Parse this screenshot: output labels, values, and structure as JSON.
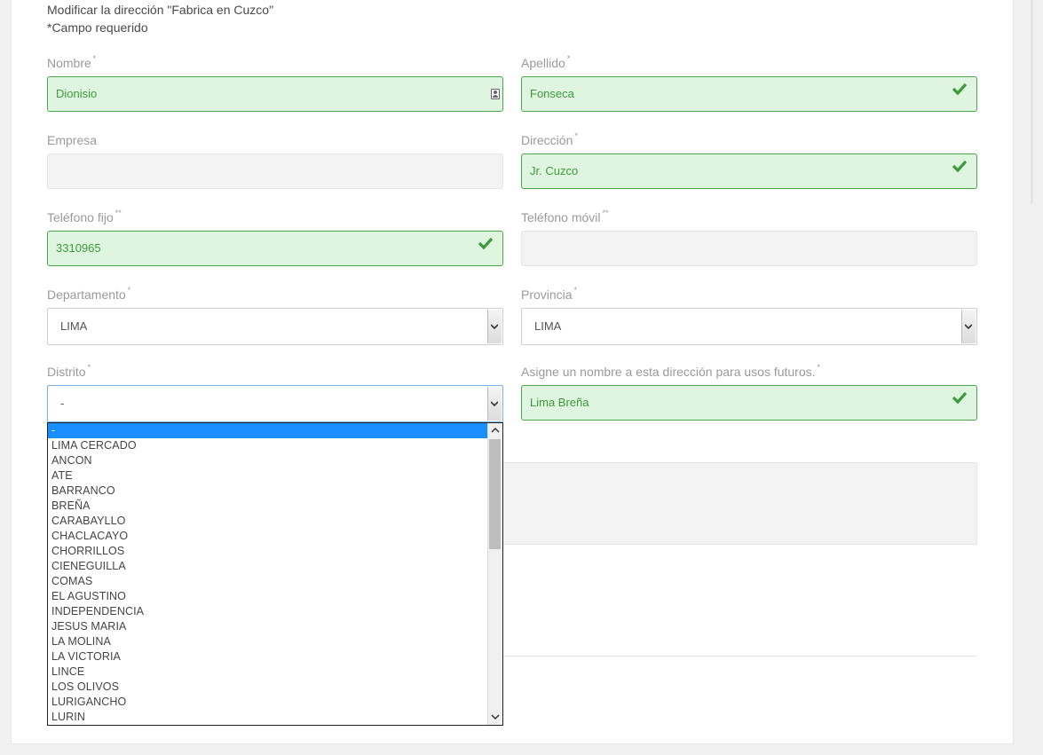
{
  "form": {
    "title": "Modificar la dirección \"Fabrica en Cuzco\"",
    "required_note": "*Campo requerido",
    "fields": {
      "nombre": {
        "label": "Nombre",
        "req": "*",
        "value": "Dionisio"
      },
      "apellido": {
        "label": "Apellido",
        "req": "*",
        "value": "Fonseca"
      },
      "empresa": {
        "label": "Empresa",
        "value": ""
      },
      "direccion": {
        "label": "Dirección",
        "req": "*",
        "value": "Jr. Cuzco"
      },
      "telefono_fijo": {
        "label": "Teléfono fijo",
        "req": "**",
        "value": "3310965"
      },
      "telefono_movil": {
        "label": "Teléfono móvil",
        "req": "**",
        "value": ""
      },
      "departamento": {
        "label": "Departamento",
        "req": "*",
        "value": "LIMA"
      },
      "provincia": {
        "label": "Provincia",
        "req": "*",
        "value": "LIMA"
      },
      "distrito": {
        "label": "Distrito",
        "req": "*",
        "value": "-"
      },
      "alias": {
        "label": "Asigne un nombre a esta dirección para usos futuros.",
        "req": "*",
        "value": "Lima Breña"
      }
    },
    "distrito_options": [
      "-",
      "LIMA CERCADO",
      "ANCON",
      "ATE",
      "BARRANCO",
      "BREÑA",
      "CARABAYLLO",
      "CHACLACAYO",
      "CHORRILLOS",
      "CIENEGUILLA",
      "COMAS",
      "EL AGUSTINO",
      "INDEPENDENCIA",
      "JESUS MARIA",
      "LA MOLINA",
      "LA VICTORIA",
      "LINCE",
      "LOS OLIVOS",
      "LURIGANCHO",
      "LURIN"
    ]
  },
  "colors": {
    "valid_bg": "#dff5df",
    "valid_border": "#4aa84a",
    "empty_bg": "#f3f3f3",
    "highlight": "#1a8fff"
  },
  "icons": {
    "valid": "check-icon",
    "contact": "contact-card-icon",
    "select_arrow": "chevron-down-icon"
  }
}
